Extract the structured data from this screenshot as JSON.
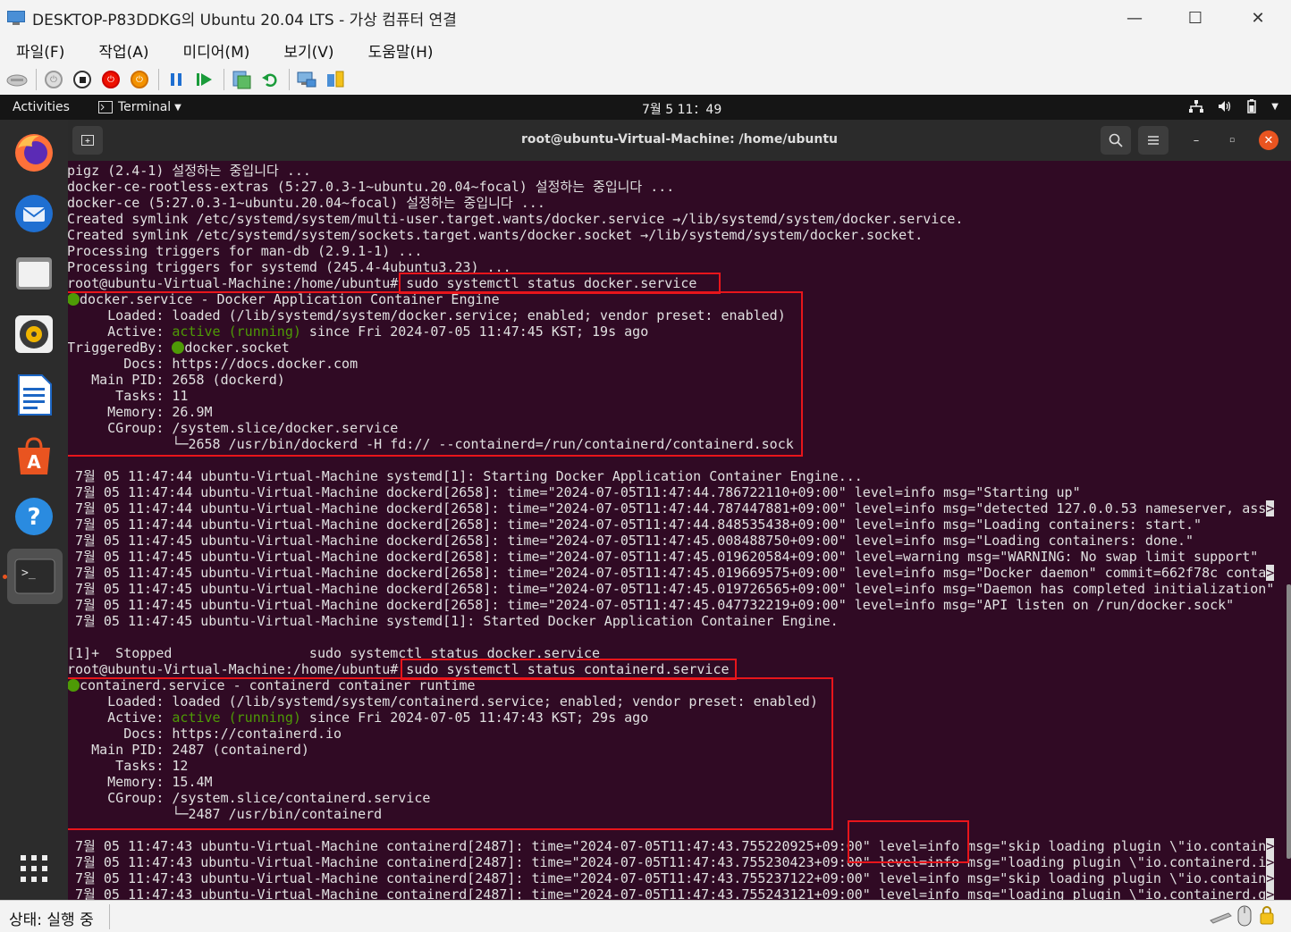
{
  "window": {
    "title": "DESKTOP-P83DDKG의 Ubuntu 20.04 LTS - 가상 컴퓨터 연결",
    "minimize": "—",
    "maximize": "☐",
    "close": "✕"
  },
  "menu": [
    "파일(F)",
    "작업(A)",
    "미디어(M)",
    "보기(V)",
    "도움말(H)"
  ],
  "toolbar": {
    "icons": [
      "ctrl-alt-del-icon",
      "start-icon",
      "turn-off-icon",
      "shutdown-icon",
      "save-icon",
      "pause-icon",
      "resume-icon",
      "checkpoint-icon",
      "revert-icon",
      "enhanced-session-icon",
      "share-icon"
    ]
  },
  "topbar": {
    "activities": "Activities",
    "app_menu": "Terminal",
    "clock": "7월 5  11：49"
  },
  "terminal": {
    "title": "root@ubuntu-Virtual-Machine: /home/ubuntu",
    "prompt": "root@ubuntu-Virtual-Machine:/home/ubuntu#",
    "cmd1": " sudo systemctl status docker.service",
    "cmd2": " sudo systemctl status containerd.service",
    "pre_lines": [
      "pigz (2.4-1) 설정하는 중입니다 ...",
      "docker-ce-rootless-extras (5:27.0.3-1~ubuntu.20.04~focal) 설정하는 중입니다 ...",
      "docker-ce (5:27.0.3-1~ubuntu.20.04~focal) 설정하는 중입니다 ...",
      "Created symlink /etc/systemd/system/multi-user.target.wants/docker.service →/lib/systemd/system/docker.service.",
      "Created symlink /etc/systemd/system/sockets.target.wants/docker.socket →/lib/systemd/system/docker.socket.",
      "Processing triggers for man-db (2.9.1-1) ...",
      "Processing triggers for systemd (245.4-4ubuntu3.23) ..."
    ],
    "docker": {
      "unit": "docker.service - Docker Application Container Engine",
      "loaded": "     Loaded: loaded (/lib/systemd/system/docker.service; enabled; vendor preset: enabled)",
      "active_label": "     Active: ",
      "active_state": "active (running)",
      "active_rest": " since Fri 2024-07-05 11:47:45 KST; 19s ago",
      "triggered_label": "TriggeredBy: ",
      "triggered_value": "docker.socket",
      "docs": "       Docs: https://docs.docker.com",
      "pid": "   Main PID: 2658 (dockerd)",
      "tasks": "      Tasks: 11",
      "memory": "     Memory: 26.9M",
      "cgroup": "     CGroup: /system.slice/docker.service",
      "cgroup_sub": "             └─2658 /usr/bin/dockerd -H fd:// --containerd=/run/containerd/containerd.sock"
    },
    "docker_logs": [
      " 7월 05 11:47:44 ubuntu-Virtual-Machine systemd[1]: Starting Docker Application Container Engine...",
      " 7월 05 11:47:44 ubuntu-Virtual-Machine dockerd[2658]: time=\"2024-07-05T11:47:44.786722110+09:00\" level=info msg=\"Starting up\"",
      " 7월 05 11:47:44 ubuntu-Virtual-Machine dockerd[2658]: time=\"2024-07-05T11:47:44.787447881+09:00\" level=info msg=\"detected 127.0.0.53 nameserver, ass",
      " 7월 05 11:47:44 ubuntu-Virtual-Machine dockerd[2658]: time=\"2024-07-05T11:47:44.848535438+09:00\" level=info msg=\"Loading containers: start.\"",
      " 7월 05 11:47:45 ubuntu-Virtual-Machine dockerd[2658]: time=\"2024-07-05T11:47:45.008488750+09:00\" level=info msg=\"Loading containers: done.\"",
      " 7월 05 11:47:45 ubuntu-Virtual-Machine dockerd[2658]: time=\"2024-07-05T11:47:45.019620584+09:00\" level=warning msg=\"WARNING: No swap limit support\"",
      " 7월 05 11:47:45 ubuntu-Virtual-Machine dockerd[2658]: time=\"2024-07-05T11:47:45.019669575+09:00\" level=info msg=\"Docker daemon\" commit=662f78c conta",
      " 7월 05 11:47:45 ubuntu-Virtual-Machine dockerd[2658]: time=\"2024-07-05T11:47:45.019726565+09:00\" level=info msg=\"Daemon has completed initialization\"",
      " 7월 05 11:47:45 ubuntu-Virtual-Machine dockerd[2658]: time=\"2024-07-05T11:47:45.047732219+09:00\" level=info msg=\"API listen on /run/docker.sock\"",
      " 7월 05 11:47:45 ubuntu-Virtual-Machine systemd[1]: Started Docker Application Container Engine."
    ],
    "stopped": "[1]+  Stopped                 sudo systemctl status docker.service",
    "containerd": {
      "unit": "containerd.service - containerd container runtime",
      "loaded": "     Loaded: loaded (/lib/systemd/system/containerd.service; enabled; vendor preset: enabled)",
      "active_label": "     Active: ",
      "active_state": "active (running)",
      "active_rest": " since Fri 2024-07-05 11:47:43 KST; 29s ago",
      "docs": "       Docs: https://containerd.io",
      "pid": "   Main PID: 2487 (containerd)",
      "tasks": "      Tasks: 12",
      "memory": "     Memory: 15.4M",
      "cgroup": "     CGroup: /system.slice/containerd.service",
      "cgroup_sub": "             └─2487 /usr/bin/containerd"
    },
    "containerd_logs": [
      " 7월 05 11:47:43 ubuntu-Virtual-Machine containerd[2487]: time=\"2024-07-05T11:47:43.755220925+09:00\" level=info msg=\"skip loading plugin \\\"io.contain",
      " 7월 05 11:47:43 ubuntu-Virtual-Machine containerd[2487]: time=\"2024-07-05T11:47:43.755230423+09:00\" level=info msg=\"loading plugin \\\"io.containerd.i",
      " 7월 05 11:47:43 ubuntu-Virtual-Machine containerd[2487]: time=\"2024-07-05T11:47:43.755237122+09:00\" level=info msg=\"skip loading plugin \\\"io.contain",
      " 7월 05 11:47:43 ubuntu-Virtual-Machine containerd[2487]: time=\"2024-07-05T11:47:43.755243121+09:00\" level=info msg=\"loading plugin \\\"io.containerd.g"
    ]
  },
  "statusbar": {
    "status": "상태: 실행 중"
  }
}
